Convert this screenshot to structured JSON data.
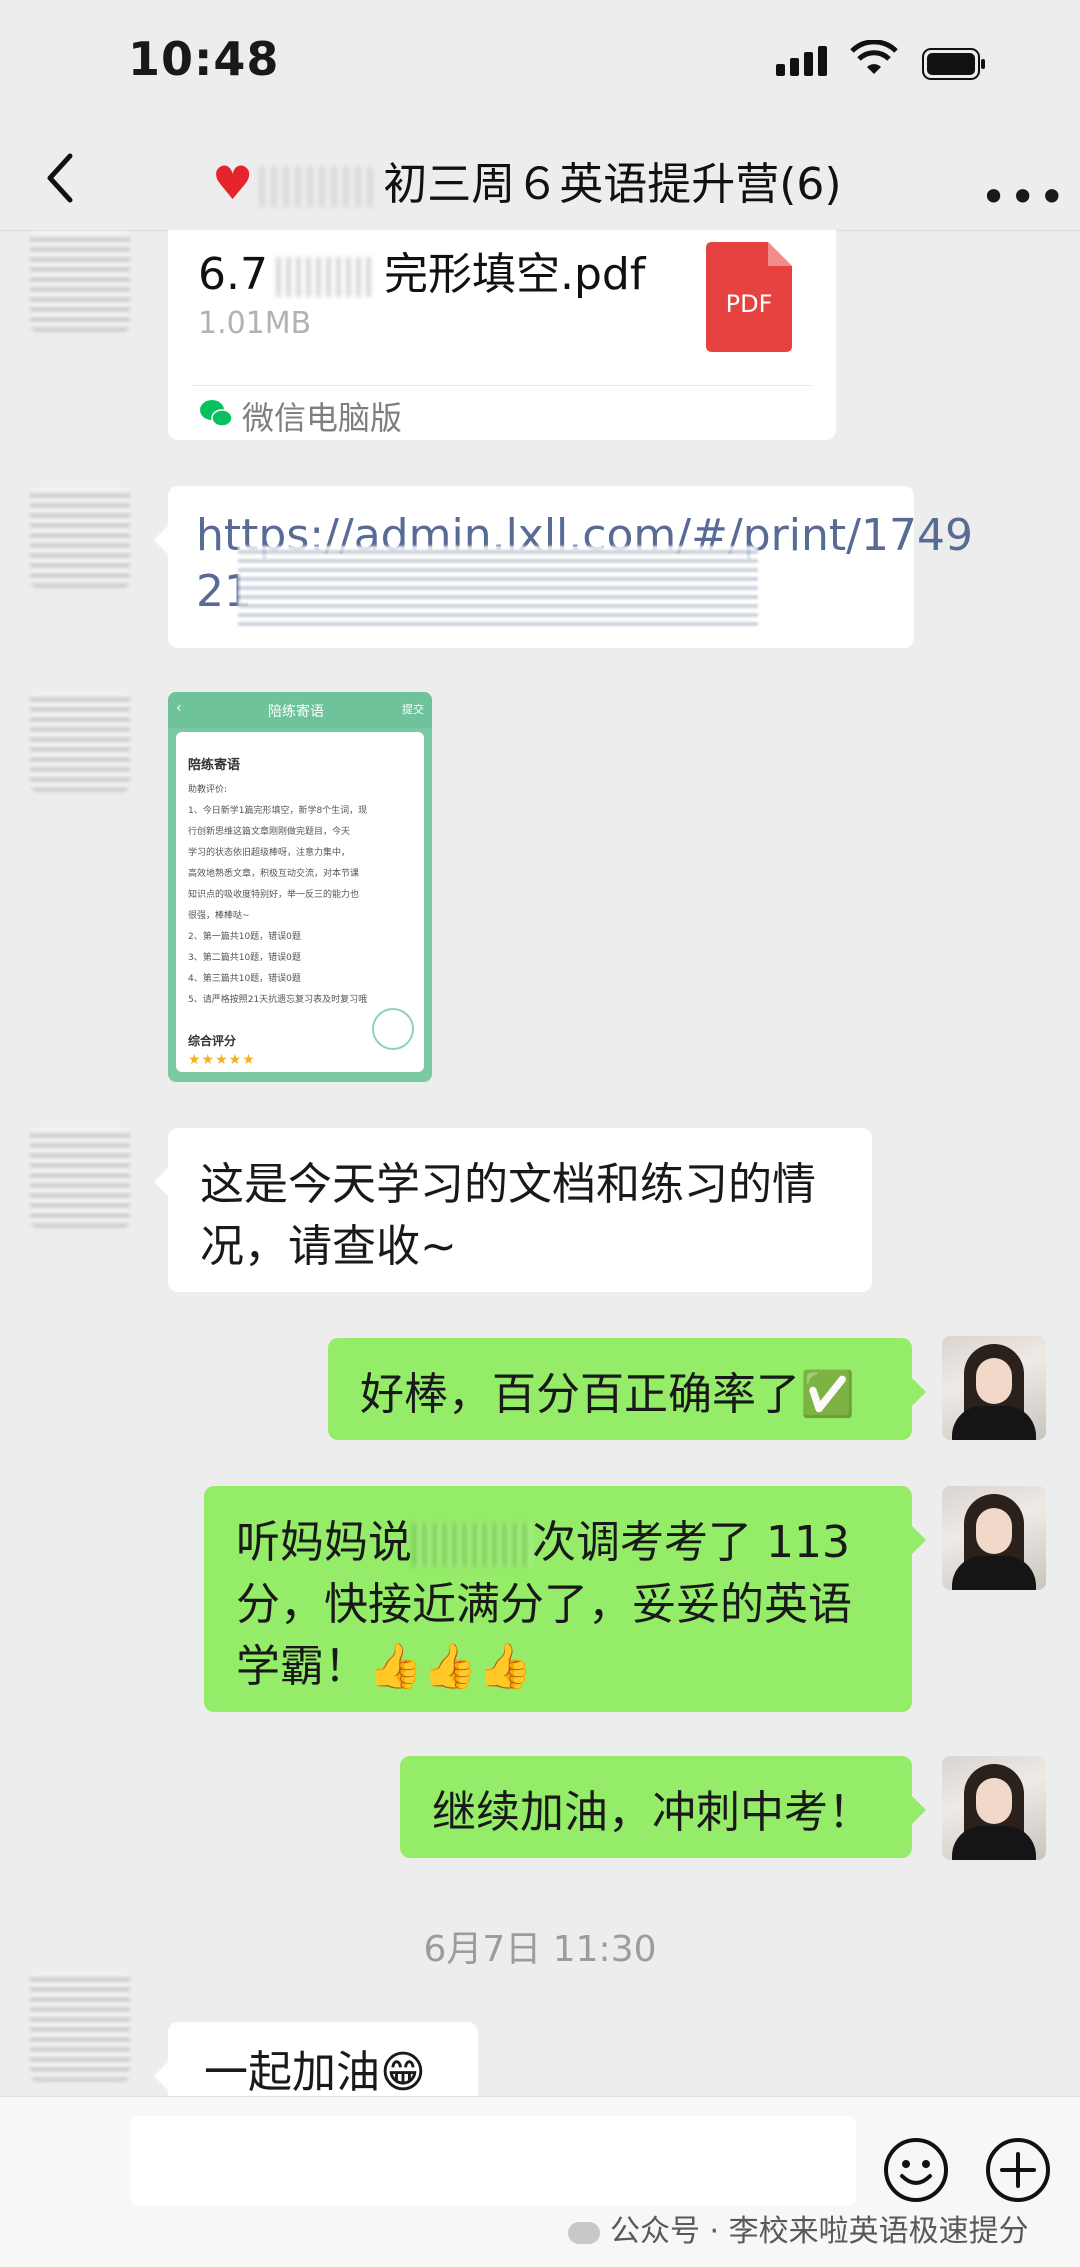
{
  "status_bar": {
    "time": "10:48"
  },
  "header": {
    "title": "初三周６英语提升营(6)",
    "more": "•••"
  },
  "messages": {
    "file": {
      "name_prefix": "6.7",
      "name_suffix": "完形填空.pdf",
      "size": "1.01MB",
      "type_label": "PDF",
      "source": "微信电脑版"
    },
    "link": {
      "url": "https://admin.lxll.com/#/print/1749",
      "url_cont": "21"
    },
    "screenshot": {
      "header": "陪练寄语",
      "submit": "提交",
      "card_title": "陪练寄语",
      "lines": [
        "助教评价:",
        "1、今日新学1篇完形填空，新学8个生词，现",
        "行创新思维这篇文章刚刚做完题目，今天",
        "学习的状态依旧超级棒呀，注意力集中，",
        "高效地熟悉文章，积极互动交流，对本节课",
        "知识点的吸收度特别好，举一反三的能力也",
        "很强，棒棒哒~",
        "2、第一篇共10题，错误0题",
        "3、第二篇共10题，错误0题",
        "4、第三篇共10题，错误0题",
        "5、请严格按照21天抗遗忘复习表及时复习哦"
      ],
      "rating_label": "综合评分",
      "stars": "★★★★★"
    },
    "text1": {
      "line1": "这是今天学习的文档和练习的情",
      "line2": "况，请查收~"
    },
    "me1": "好棒，百分百正确率了✅",
    "me2": {
      "line1a": "听妈妈说",
      "line1b": "次调考考了 113",
      "line2": "分，快接近满分了，妥妥的英语",
      "line3": "学霸！👍👍👍"
    },
    "me3": "继续加油，冲刺中考！",
    "timestamp": "6月7日 11:30",
    "text2": "一起加油😁"
  },
  "watermark": "公众号 · 李校来啦英语极速提分"
}
